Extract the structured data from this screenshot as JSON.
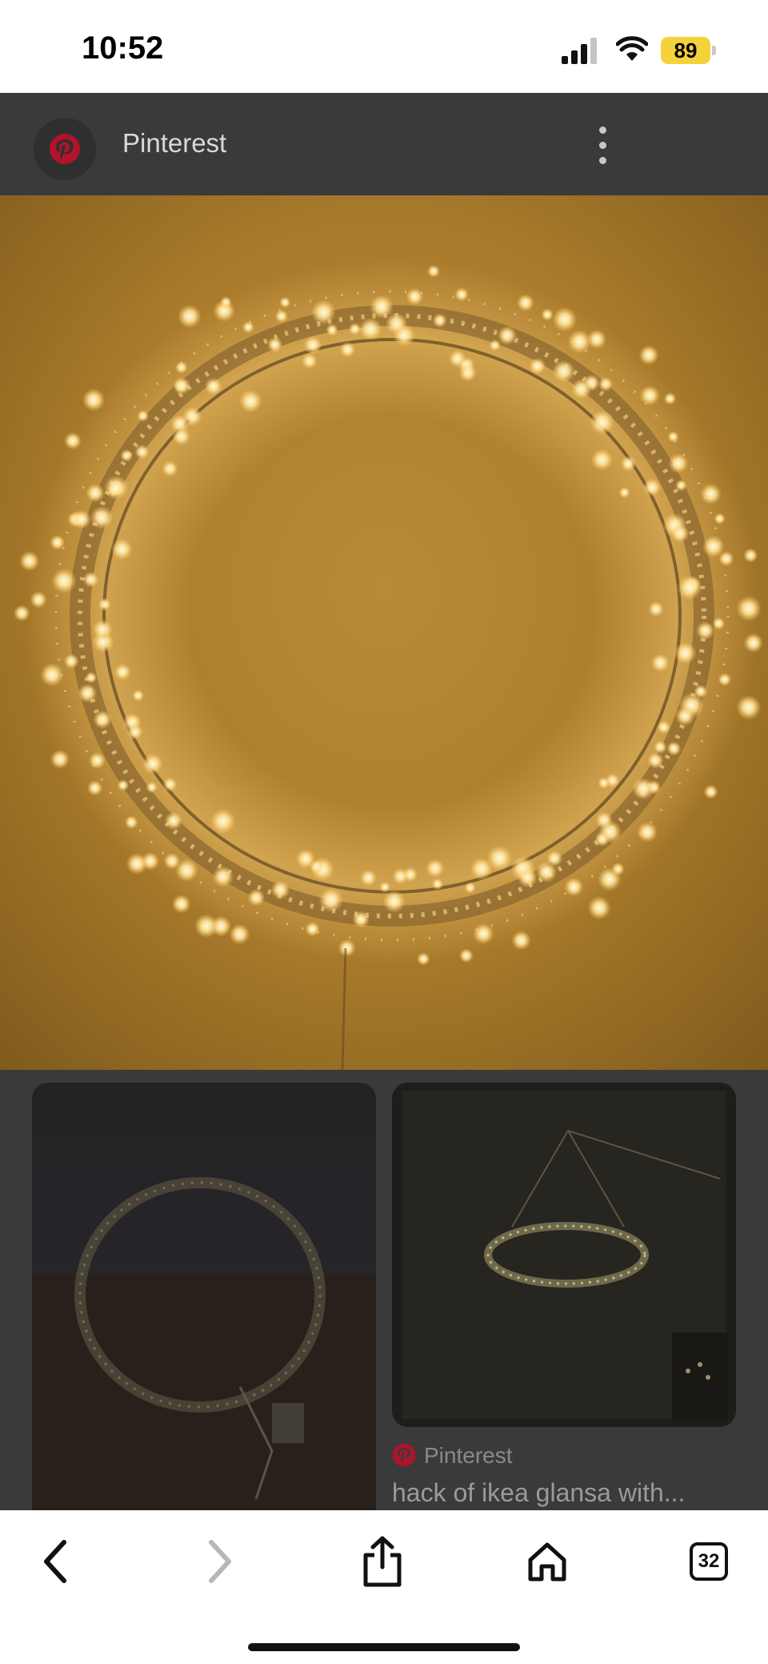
{
  "status_bar": {
    "time": "10:52",
    "battery_level": "89",
    "icons": [
      "cellular-signal-icon",
      "wifi-icon",
      "battery-icon"
    ]
  },
  "header": {
    "site_name": "Pinterest",
    "icons": [
      "pinterest-logo-icon",
      "more-vertical-icon"
    ]
  },
  "hero_image": {
    "subject": "glowing ring-shaped string-light wreath"
  },
  "related": {
    "source_label": "Pinterest",
    "caption": "hack of ikea glansa with..."
  },
  "toolbar": {
    "tabs_count": "32",
    "icons": [
      "back-icon",
      "forward-icon",
      "share-icon",
      "home-icon",
      "tabs-icon"
    ]
  },
  "colors": {
    "accent_pinterest": "#b2132a",
    "battery": "#f4d23a",
    "page_background": "#3a3a3b"
  }
}
